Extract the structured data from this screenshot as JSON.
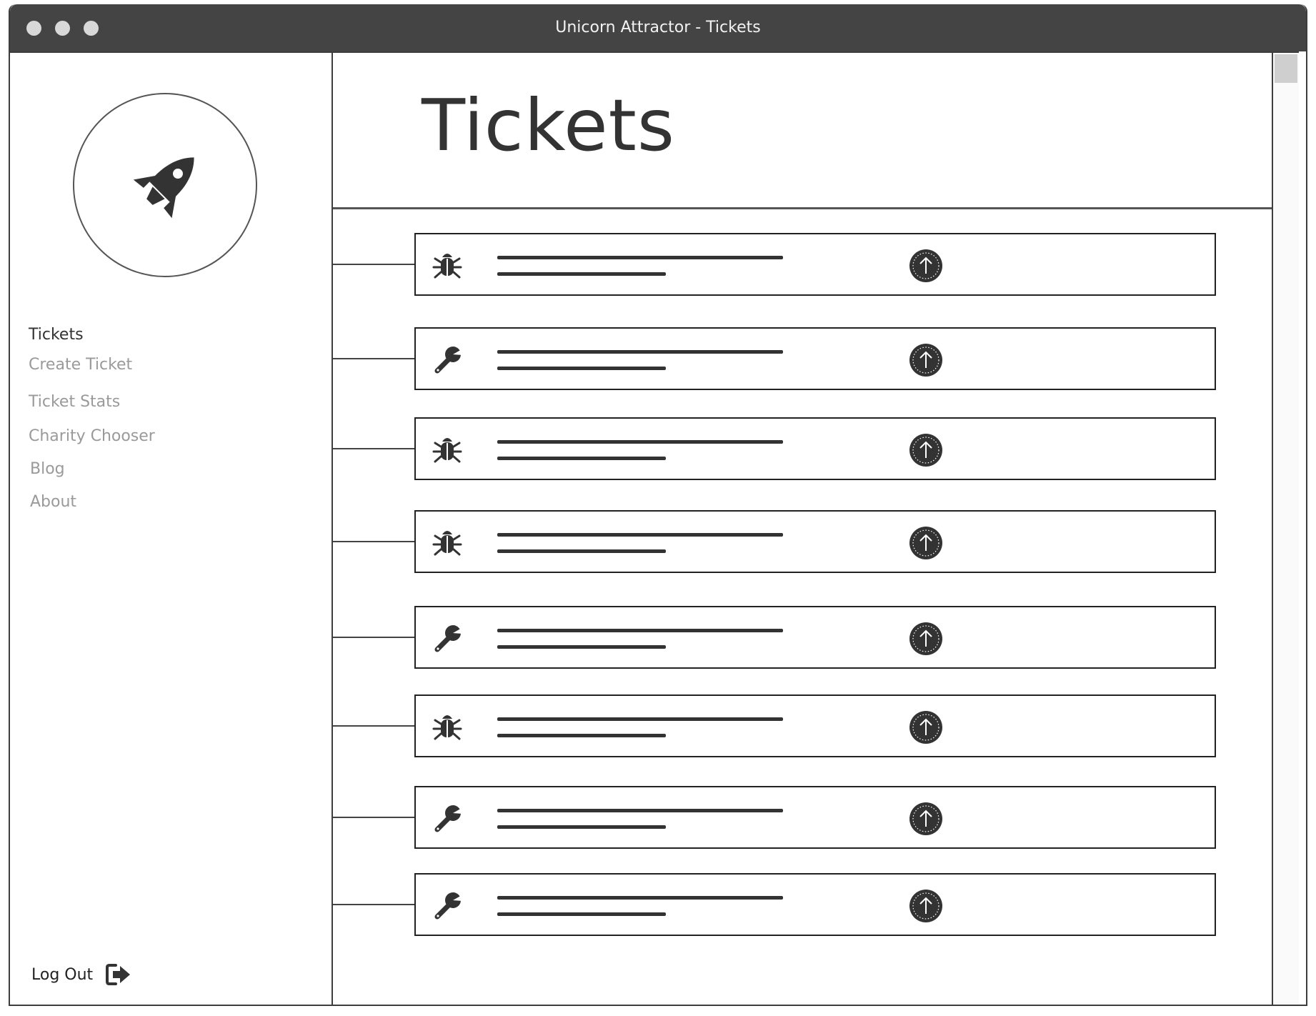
{
  "window": {
    "title": "Unicorn Attractor - Tickets"
  },
  "sidebar": {
    "logo_icon": "rocket-icon",
    "items": [
      {
        "label": "Tickets",
        "active": true
      },
      {
        "label": "Create Ticket",
        "active": false
      },
      {
        "label": "Ticket Stats",
        "active": false
      },
      {
        "label": "Charity Chooser",
        "active": false
      },
      {
        "label": "Blog",
        "active": false
      },
      {
        "label": "About",
        "active": false
      }
    ],
    "logout": {
      "label": "Log Out",
      "icon": "sign-out-icon"
    }
  },
  "main": {
    "title": "Tickets",
    "tickets": [
      {
        "type": "bug"
      },
      {
        "type": "feature"
      },
      {
        "type": "bug"
      },
      {
        "type": "bug"
      },
      {
        "type": "feature"
      },
      {
        "type": "bug"
      },
      {
        "type": "feature"
      },
      {
        "type": "feature"
      }
    ]
  },
  "colors": {
    "titlebar": "#444444",
    "text_dark": "#333333",
    "text_muted": "#9a9a9a",
    "icon": "#333333"
  }
}
